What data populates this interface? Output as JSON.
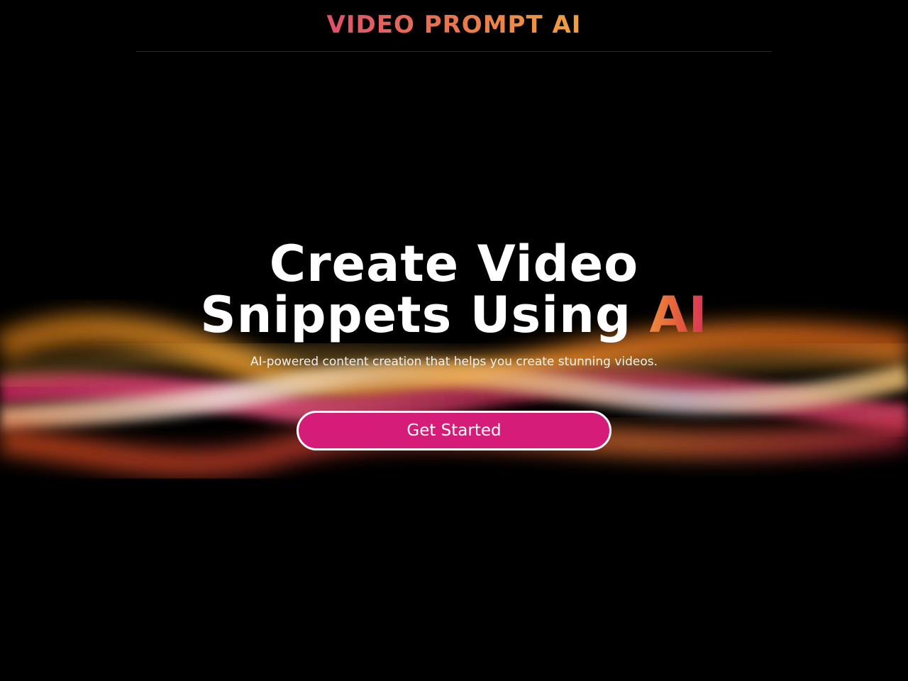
{
  "header": {
    "logo_text": "VIDEO PROMPT AI"
  },
  "hero": {
    "headline_line1": "Create Video",
    "headline_line2_prefix": "Snippets Using ",
    "headline_accent": "AI",
    "subtitle": "AI-powered content creation that helps you create stunning videos.",
    "cta_label": "Get Started"
  },
  "colors": {
    "background": "#000000",
    "brand_gradient_start": "#e0506a",
    "brand_gradient_end": "#f0a040",
    "cta_background": "#d41c78",
    "cta_border": "#ffffff",
    "wave_orange": "#f28a1c",
    "wave_pink": "#e0407a",
    "wave_cream": "#f5c89a"
  }
}
